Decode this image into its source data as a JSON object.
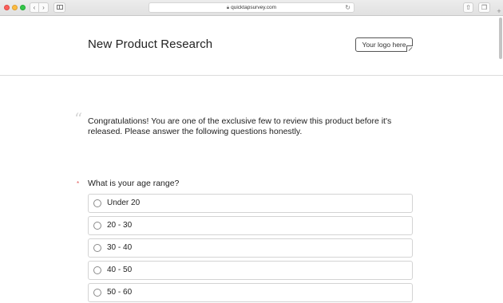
{
  "browser": {
    "url": "quicktapsurvey.com"
  },
  "header": {
    "title": "New Product Research",
    "logo_text": "Your logo here"
  },
  "intro": {
    "text": "Congratulations! You are one of the exclusive few to review this product before it's released. Please answer the following questions honestly."
  },
  "question": {
    "required_mark": "*",
    "text": "What is your age range?",
    "options": [
      {
        "label": "Under 20"
      },
      {
        "label": "20 - 30"
      },
      {
        "label": "30 - 40"
      },
      {
        "label": "40 - 50"
      },
      {
        "label": "50 - 60"
      }
    ]
  }
}
